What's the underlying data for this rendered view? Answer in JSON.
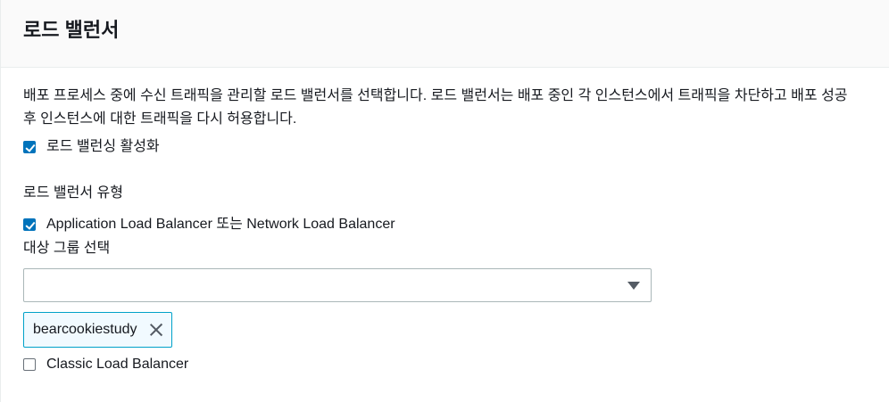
{
  "panel": {
    "title": "로드 밸런서",
    "description": "배포 프로세스 중에 수신 트래픽을 관리할 로드 밸런서를 선택합니다. 로드 밸런서는 배포 중인 각 인스턴스에서 트래픽을 차단하고 배포 성공 후 인스턴스에 대한 트래픽을 다시 허용합니다."
  },
  "enable_load_balancing": {
    "label": "로드 밸런싱 활성화",
    "checked": true
  },
  "load_balancer_type": {
    "label": "로드 밸런서 유형",
    "alb_nlb": {
      "label": "Application Load Balancer 또는 Network Load Balancer",
      "checked": true
    },
    "target_group": {
      "label": "대상 그룹 선택",
      "selected_value": "",
      "icon": "caret-down-icon"
    },
    "tokens": [
      {
        "label": "bearcookiestudy",
        "icon": "close-icon"
      }
    ],
    "classic": {
      "label": "Classic Load Balancer",
      "checked": false
    }
  },
  "colors": {
    "accent": "#0073bb",
    "token_border": "#00a1c9",
    "token_bg": "#f1faff",
    "header_bg": "#fafafa",
    "text": "#16191f"
  }
}
